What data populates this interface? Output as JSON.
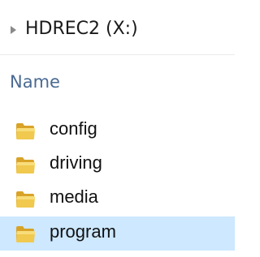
{
  "colors": {
    "selection": "#cde8ff",
    "header_text": "#4a6a93",
    "folder_front": "#f0c94e",
    "folder_back": "#d8a328"
  },
  "navigation": {
    "expand_icon": "chevron-right-icon",
    "drive_label": "HDREC2 (X:)"
  },
  "columns": {
    "name": "Name"
  },
  "files": [
    {
      "name": "config",
      "icon": "folder-icon",
      "selected": false
    },
    {
      "name": "driving",
      "icon": "folder-icon",
      "selected": false
    },
    {
      "name": "media",
      "icon": "folder-icon",
      "selected": false
    },
    {
      "name": "program",
      "icon": "folder-icon",
      "selected": true
    }
  ]
}
